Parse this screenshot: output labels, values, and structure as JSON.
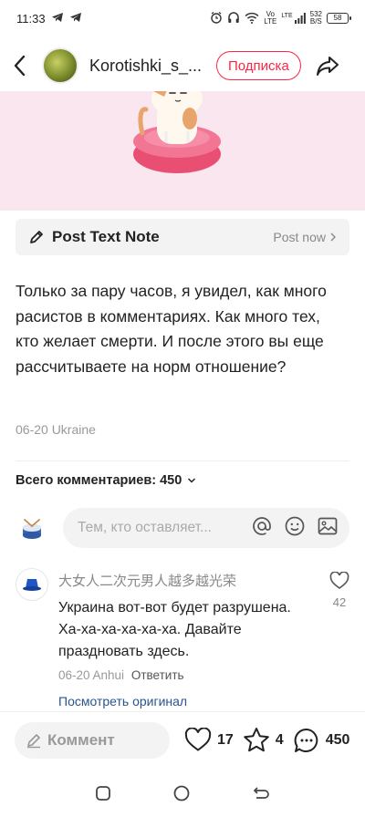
{
  "status_bar": {
    "time": "11:33",
    "network_speed": "532\nB/S",
    "network_speed_top": "532",
    "network_speed_bottom": "B/S",
    "signal_label_top": "Vo",
    "signal_label_bottom": "LTE",
    "lte_label": "LTE",
    "battery": "58"
  },
  "header": {
    "user_name": "Korotishki_s_...",
    "follow_label": "Подписка"
  },
  "note_bar": {
    "title": "Post Text Note",
    "action": "Post now"
  },
  "post": {
    "text": "Только за пару часов, я увидел, как много расистов в комментариях. Как много тех, кто желает смерти. И после этого вы еще рассчитываете на норм отношение?",
    "meta": "06-20 Ukraine"
  },
  "comments": {
    "total_label": "Всего комментариев: 450",
    "input_placeholder": "Тем, кто оставляет...",
    "items": [
      {
        "author": "大女人二次元男人越多越光荣",
        "text": "Украина вот-вот будет разрушена. Ха-ха-ха-ха-ха-ха. Давайте праздновать здесь.",
        "date_location": "06-20 Anhui",
        "reply_label": "Ответить",
        "likes": "42",
        "view_original": "Посмотреть оригинал"
      }
    ]
  },
  "bottom_bar": {
    "input_label": "Коммент",
    "likes": "17",
    "stars": "4",
    "comments": "450"
  },
  "colors": {
    "accent": "#ff2442",
    "image_bg": "#f9e6ee",
    "link": "#27558c"
  }
}
